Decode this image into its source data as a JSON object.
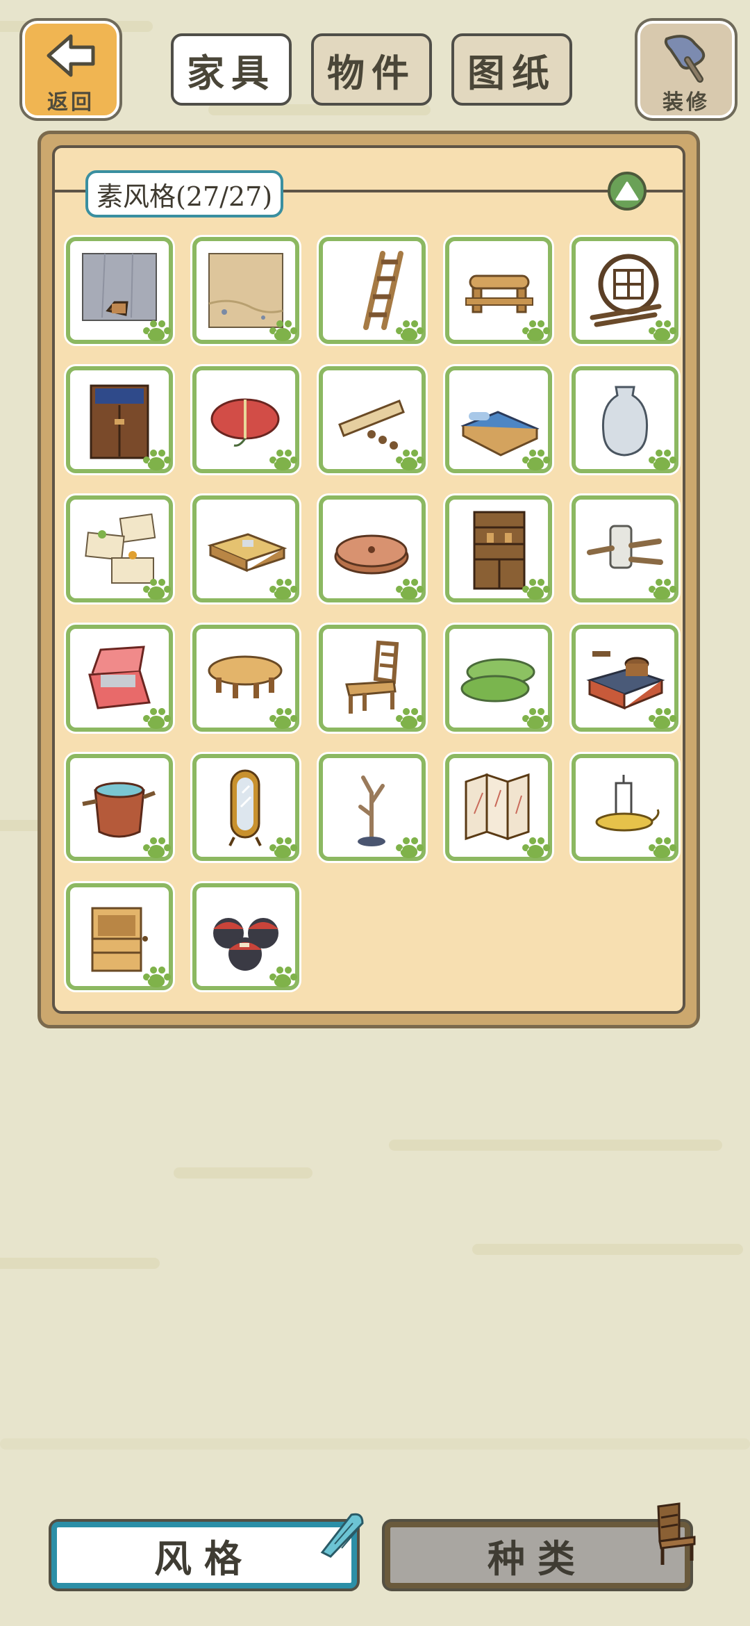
{
  "top_bar": {
    "back_label": "返回",
    "tabs": [
      {
        "label": "家具",
        "active": true
      },
      {
        "label": "物件",
        "active": false
      },
      {
        "label": "图纸",
        "active": false
      }
    ],
    "decorate_label": "装修"
  },
  "panel": {
    "style_title": "素风格(27/27)",
    "items": [
      {
        "icon": "stone-wall-tub-icon"
      },
      {
        "icon": "sand-floor-icon"
      },
      {
        "icon": "wooden-ladder-icon"
      },
      {
        "icon": "log-bench-icon"
      },
      {
        "icon": "round-lattice-window-icon"
      },
      {
        "icon": "wooden-door-curtain-icon"
      },
      {
        "icon": "red-bundle-icon"
      },
      {
        "icon": "scroll-beads-icon"
      },
      {
        "icon": "blue-bed-icon"
      },
      {
        "icon": "white-vase-icon"
      },
      {
        "icon": "note-papers-icon"
      },
      {
        "icon": "low-table-icon"
      },
      {
        "icon": "round-cushion-icon"
      },
      {
        "icon": "wooden-cabinet-icon"
      },
      {
        "icon": "scroll-rolls-icon"
      },
      {
        "icon": "red-chest-icon"
      },
      {
        "icon": "round-wood-table-icon"
      },
      {
        "icon": "wooden-chair-icon"
      },
      {
        "icon": "green-rolls-icon"
      },
      {
        "icon": "clay-stove-icon"
      },
      {
        "icon": "water-barrel-icon"
      },
      {
        "icon": "standing-mirror-icon"
      },
      {
        "icon": "branch-stand-icon"
      },
      {
        "icon": "folding-screen-icon"
      },
      {
        "icon": "candle-holder-icon"
      },
      {
        "icon": "side-cabinet-icon"
      },
      {
        "icon": "sauce-jars-icon"
      }
    ]
  },
  "bottom": {
    "style_label": "风格",
    "kind_label": "种类"
  },
  "colors": {
    "tile_border": "#8cb861",
    "accent_teal": "#2c8fa7",
    "panel_bg": "#f7dfb1"
  }
}
